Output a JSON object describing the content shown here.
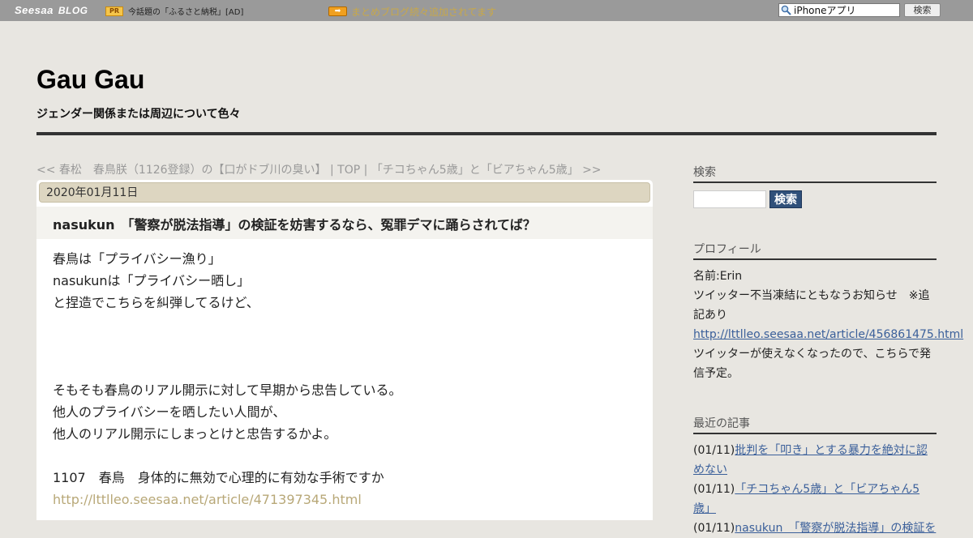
{
  "topbar": {
    "logo_main": "Seesaa",
    "logo_sub": "BLOG",
    "pr_badge": "PR",
    "pr_text": "今話題の「ふるさと納税」[AD]",
    "announcement": "まとめブログ続々追加されてます",
    "search_value": "iPhoneアプリ",
    "search_button": "検索"
  },
  "header": {
    "title": "Gau Gau",
    "description": "ジェンダー関係または周辺について色々"
  },
  "nav": {
    "prev": "<< 春松　春鳥朕（1126登録）の【口がドブ川の臭い】",
    "sep1": " | ",
    "top": "TOP",
    "sep2": " | ",
    "next": "「チコちゃん5歳」と「ビアちゃん5歳」 >>"
  },
  "article": {
    "date": "2020年01月11日",
    "title": "nasukun　「警察が脱法指導」の検証を妨害するなら、冤罪デマに踊らされてば？",
    "lines": [
      "春鳥は「プライバシー漁り」",
      "nasukunは「プライバシー晒し」",
      "と捏造でこちらを糾弾してるけど、",
      "",
      "",
      "",
      "そもそも春鳥のリアル開示に対して早期から忠告している。",
      "他人のプライバシーを晒したい人間が、",
      "他人のリアル開示にしまっとけと忠告するかよ。",
      "",
      "1107　春鳥　身体的に無効で心理的に有効な手術ですか"
    ],
    "link": "http://lttlleo.seesaa.net/article/471397345.html"
  },
  "sidebar": {
    "search_heading": "検索",
    "search_button": "検索",
    "profile_heading": "プロフィール",
    "profile_name": "名前:Erin",
    "profile_note": "ツイッター不当凍結にともなうお知らせ　※追記あり",
    "profile_link": "http://lttlleo.seesaa.net/article/456861475.html",
    "profile_note2": "ツイッターが使えなくなったので、こちらで発信予定。",
    "recent_heading": "最近の記事",
    "recent": [
      {
        "date": "(01/11)",
        "title": "批判を「叩き」とする暴力を絶対に認めない"
      },
      {
        "date": "(01/11)",
        "title": "「チコちゃん5歳」と「ビアちゃん5歳」"
      },
      {
        "date": "(01/11)",
        "title": "nasukun　「警察が脱法指導」の検証を"
      }
    ]
  },
  "colors": {
    "background": "#e8e6e1",
    "topbar": "#9a9a9a",
    "date_bar": "#ddd6c1",
    "sidebar_link": "#3a5f9a",
    "article_link": "#b8a878",
    "search_button": "#30507a"
  }
}
